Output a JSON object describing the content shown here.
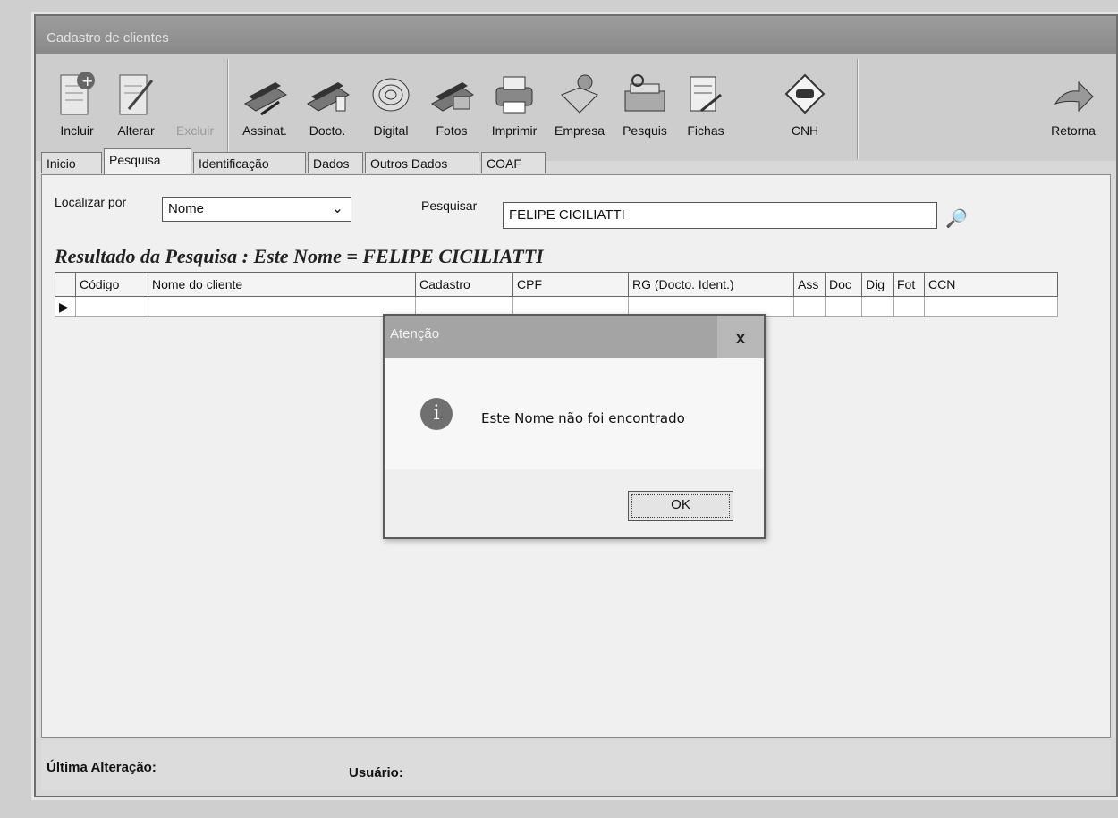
{
  "window": {
    "title": "Cadastro de clientes"
  },
  "toolbar": {
    "buttons": [
      {
        "label": "Incluir",
        "icon": "add-document-icon",
        "enabled": true
      },
      {
        "label": "Alterar",
        "icon": "edit-document-icon",
        "enabled": true
      },
      {
        "label": "Excluir",
        "icon": "delete-document-icon",
        "enabled": false
      },
      {
        "label": "Assinat.",
        "icon": "scanner-signature-icon",
        "enabled": true
      },
      {
        "label": "Docto.",
        "icon": "scanner-document-icon",
        "enabled": true
      },
      {
        "label": "Digital",
        "icon": "fingerprint-icon",
        "enabled": true
      },
      {
        "label": "Fotos",
        "icon": "scanner-photo-icon",
        "enabled": true
      },
      {
        "label": "Imprimir",
        "icon": "printer-icon",
        "enabled": true
      },
      {
        "label": "Empresa",
        "icon": "company-icon",
        "enabled": true
      },
      {
        "label": "Pesquis",
        "icon": "search-records-icon",
        "enabled": true
      },
      {
        "label": "Fichas",
        "icon": "forms-icon",
        "enabled": true
      },
      {
        "label": "CNH",
        "icon": "driver-license-icon",
        "enabled": true
      }
    ],
    "return_label": "Retorna"
  },
  "tabs": [
    "Inicio",
    "Pesquisa",
    "Identificação",
    "Dados",
    "Outros Dados",
    "COAF"
  ],
  "active_tab": "Pesquisa",
  "search": {
    "locate_label": "Localizar por",
    "locate_value": "Nome",
    "search_label": "Pesquisar",
    "search_value": "FELIPE CICILIATTI"
  },
  "results": {
    "title": "Resultado da Pesquisa : Este Nome = FELIPE CICILIATTI",
    "columns": [
      "Código",
      "Nome do cliente",
      "Cadastro",
      "CPF",
      "RG (Docto. Ident.)",
      "Ass",
      "Doc",
      "Dig",
      "Fot",
      "CCN"
    ]
  },
  "status": {
    "last_change_label": "Última Alteração:",
    "user_label": "Usuário:"
  },
  "dialog": {
    "title": "Atenção",
    "message": "Este Nome não foi encontrado",
    "ok_label": "OK",
    "close_label": "x",
    "icon": "info-icon"
  },
  "colors": {
    "titlebar": "#8c8c8c",
    "dialog_titlebar": "#a4a4a4",
    "background": "#d8d8d8"
  }
}
